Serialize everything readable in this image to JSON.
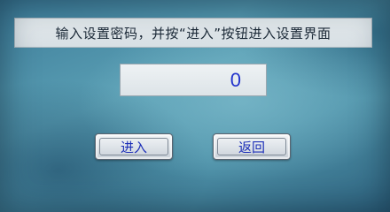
{
  "header": {
    "instruction": "输入设置密码，并按“进入”按钮进入设置界面"
  },
  "password": {
    "value": "0"
  },
  "buttons": {
    "enter_label": "进入",
    "back_label": "返回"
  }
}
